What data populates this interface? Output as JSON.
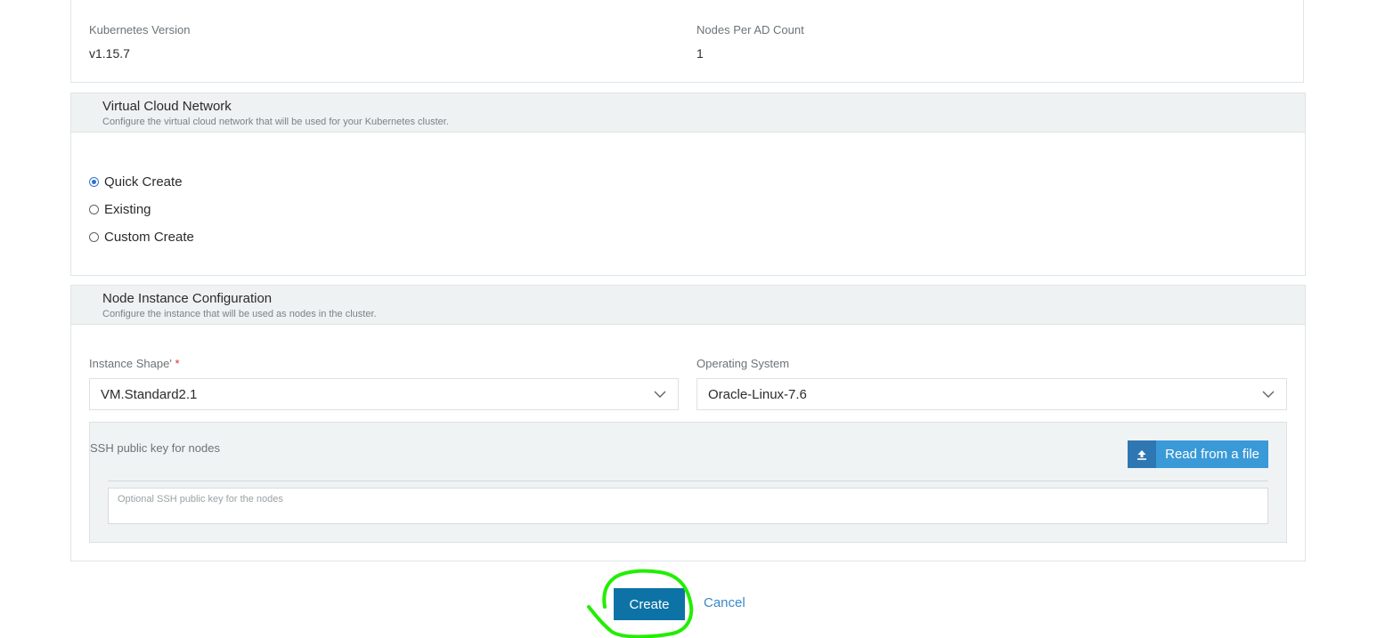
{
  "cluster_info": {
    "kubernetes_version_label": "Kubernetes Version",
    "kubernetes_version_value": "v1.15.7",
    "nodes_per_ad_label": "Nodes Per AD Count",
    "nodes_per_ad_value": "1"
  },
  "vcn_section": {
    "title": "Virtual Cloud Network",
    "description": "Configure the virtual cloud network that will be used for your Kubernetes cluster.",
    "options": [
      {
        "label": "Quick Create",
        "checked": true
      },
      {
        "label": "Existing",
        "checked": false
      },
      {
        "label": "Custom Create",
        "checked": false
      }
    ]
  },
  "node_section": {
    "title": "Node Instance Configuration",
    "description": "Configure the instance that will be used as nodes in the cluster.",
    "instance_shape_label": "Instance Shape'",
    "required_marker": "*",
    "instance_shape_value": "VM.Standard2.1",
    "os_label": "Operating System",
    "os_value": "Oracle-Linux-7.6",
    "ssh_label": "SSH public key for nodes",
    "read_file_label": "Read from a file",
    "ssh_placeholder": "Optional SSH public key for the nodes"
  },
  "footer": {
    "create_label": "Create",
    "cancel_label": "Cancel"
  },
  "colors": {
    "primary_button": "#0d73a6",
    "link": "#3a88c8",
    "highlight_annotation": "#22ee00"
  },
  "icons": {
    "upload": "upload-icon",
    "chevron": "chevron-down-icon"
  }
}
